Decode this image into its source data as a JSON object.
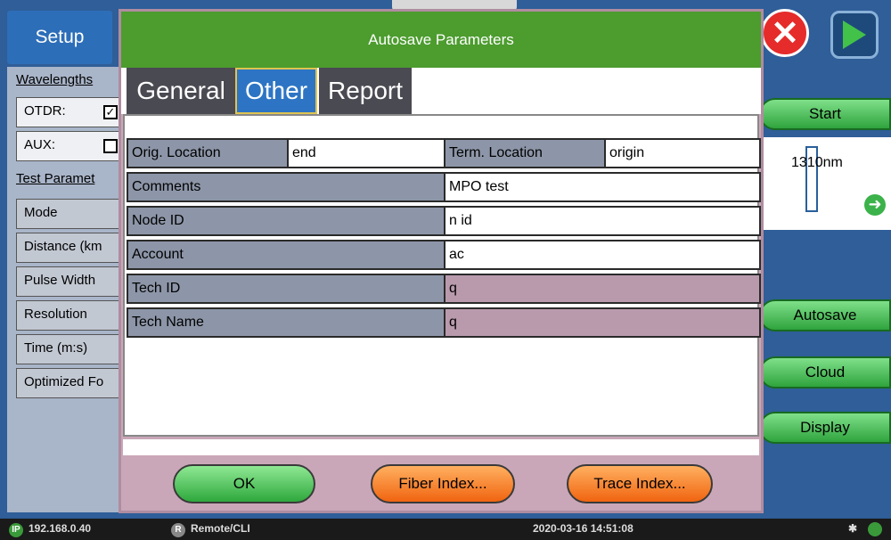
{
  "app": {
    "setup_tab": "Setup",
    "left_panel": {
      "wavelengths": "Wavelengths",
      "otdr_label": "OTDR:",
      "aux_label": "AUX:",
      "test_params": "Test Paramet",
      "rows": [
        "Mode",
        "Distance (km",
        "Pulse Width",
        "Resolution",
        "Time (m:s)",
        "Optimized Fo"
      ]
    },
    "right": {
      "start": "Start",
      "wavelength": "1310nm",
      "autosave": "Autosave",
      "cloud": "Cloud",
      "display": "Display"
    }
  },
  "dialog": {
    "title": "Autosave Parameters",
    "tabs": [
      "General",
      "Other",
      "Report"
    ],
    "active_tab": "Other",
    "fields": {
      "orig_location_label": "Orig. Location",
      "orig_location_value": "end",
      "term_location_label": "Term. Location",
      "term_location_value": "origin",
      "comments_label": "Comments",
      "comments_value": "MPO test",
      "node_id_label": "Node ID",
      "node_id_value": "n id",
      "account_label": "Account",
      "account_value": "ac",
      "tech_id_label": "Tech ID",
      "tech_id_value": "q",
      "tech_name_label": "Tech Name",
      "tech_name_value": "q"
    },
    "buttons": {
      "ok": "OK",
      "fiber_index": "Fiber Index...",
      "trace_index": "Trace Index..."
    }
  },
  "status_bar": {
    "ip_badge": "IP",
    "ip": "192.168.0.40",
    "remote_badge": "R",
    "remote": "Remote/CLI",
    "datetime": "2020-03-16  14:51:08"
  },
  "colors": {
    "title_green": "#4c9c2e",
    "active_tab_blue": "#2d75c4",
    "label_grey": "#8d96a8",
    "locked_pink": "#b99aad"
  }
}
